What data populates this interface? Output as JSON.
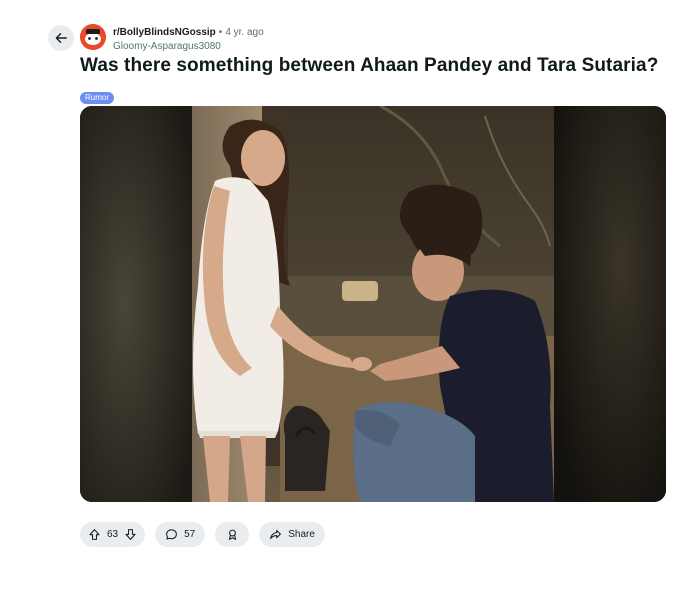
{
  "post": {
    "subreddit": "r/BollyBlindsNGossip",
    "separator": "•",
    "age": "4 yr. ago",
    "author": "Gloomy-Asparagus3080",
    "title": "Was there something between Ahaan Pandey and Tara Sutaria?",
    "flair": "Rumor"
  },
  "actions": {
    "upvotes": "63",
    "comments": "57",
    "share_label": "Share"
  },
  "icons": {
    "back": "arrow-left-icon",
    "upvote": "arrow-up-icon",
    "downvote": "arrow-down-icon",
    "comment": "speech-bubble-icon",
    "award": "award-icon",
    "share": "share-arrow-icon"
  },
  "colors": {
    "flair_bg": "#6b8ef2",
    "subreddit_avatar": "#e84a2a",
    "pill_bg": "#eaedef"
  }
}
